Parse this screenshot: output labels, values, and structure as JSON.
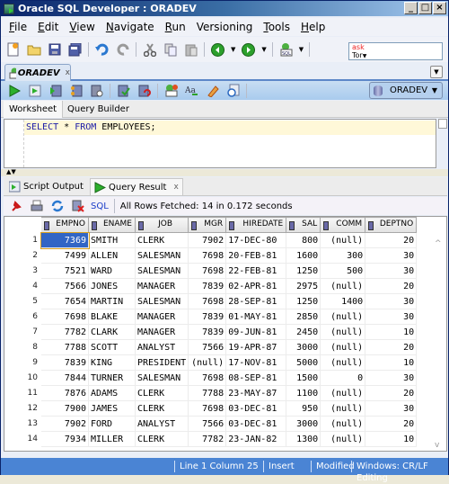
{
  "window": {
    "title": "Oracle SQL Developer : ORADEV",
    "controls": [
      "_",
      "□",
      "x"
    ]
  },
  "menu": {
    "items": [
      {
        "label": "File",
        "mnemonic": "F",
        "rest": "ile"
      },
      {
        "label": "Edit",
        "mnemonic": "E",
        "rest": "dit"
      },
      {
        "label": "View",
        "mnemonic": "V",
        "rest": "iew"
      },
      {
        "label": "Navigate",
        "mnemonic": "N",
        "rest": "avigate"
      },
      {
        "label": "Run",
        "mnemonic": "R",
        "rest": "un"
      },
      {
        "label": "Versioning",
        "mnemonic": "",
        "rest": "Versioning"
      },
      {
        "label": "Tools",
        "mnemonic": "T",
        "rest": "ools"
      },
      {
        "label": "Help",
        "mnemonic": "H",
        "rest": "elp"
      }
    ]
  },
  "toolbar": {
    "icons": [
      "new-file-icon",
      "open-folder-icon",
      "save-icon",
      "save-all-icon",
      "undo-icon",
      "redo-icon",
      "cut-icon",
      "copy-icon",
      "paste-icon",
      "back-icon",
      "forward-icon",
      "sql-connection-icon"
    ],
    "ask_line1": "ask",
    "ask_line2": "Tor"
  },
  "doc_tab": {
    "label": "ORADEV",
    "close": "x"
  },
  "worksheet_toolbar": {
    "icons": [
      "run-statement-icon",
      "run-script-icon",
      "autotrace-icon",
      "explain-plan-icon",
      "sql-tuning-icon",
      "commit-icon",
      "rollback-icon",
      "unshared-sql-icon",
      "change-case-icon",
      "clear-icon",
      "sql-history-icon"
    ],
    "connection": "ORADEV"
  },
  "subtabs": {
    "worksheet": "Worksheet",
    "query_builder": "Query Builder"
  },
  "editor": {
    "kw1": "SELECT",
    "mid": " * ",
    "kw2": "FROM",
    "rest": " EMPLOYEES;"
  },
  "result_tabs": {
    "script_output": "Script Output",
    "query_result": "Query Result",
    "close": "x"
  },
  "result_toolbar": {
    "sql_link": "SQL",
    "message": "All Rows Fetched: 14 in 0.172 seconds"
  },
  "grid": {
    "columns": [
      "EMPNO",
      "ENAME",
      "JOB",
      "MGR",
      "HIREDATE",
      "SAL",
      "COMM",
      "DEPTNO"
    ],
    "rows": [
      [
        "1",
        "7369",
        "SMITH",
        "CLERK",
        "7902",
        "17-DEC-80",
        "800",
        "(null)",
        "20"
      ],
      [
        "2",
        "7499",
        "ALLEN",
        "SALESMAN",
        "7698",
        "20-FEB-81",
        "1600",
        "300",
        "30"
      ],
      [
        "3",
        "7521",
        "WARD",
        "SALESMAN",
        "7698",
        "22-FEB-81",
        "1250",
        "500",
        "30"
      ],
      [
        "4",
        "7566",
        "JONES",
        "MANAGER",
        "7839",
        "02-APR-81",
        "2975",
        "(null)",
        "20"
      ],
      [
        "5",
        "7654",
        "MARTIN",
        "SALESMAN",
        "7698",
        "28-SEP-81",
        "1250",
        "1400",
        "30"
      ],
      [
        "6",
        "7698",
        "BLAKE",
        "MANAGER",
        "7839",
        "01-MAY-81",
        "2850",
        "(null)",
        "30"
      ],
      [
        "7",
        "7782",
        "CLARK",
        "MANAGER",
        "7839",
        "09-JUN-81",
        "2450",
        "(null)",
        "10"
      ],
      [
        "8",
        "7788",
        "SCOTT",
        "ANALYST",
        "7566",
        "19-APR-87",
        "3000",
        "(null)",
        "20"
      ],
      [
        "9",
        "7839",
        "KING",
        "PRESIDENT",
        "(null)",
        "17-NOV-81",
        "5000",
        "(null)",
        "10"
      ],
      [
        "10",
        "7844",
        "TURNER",
        "SALESMAN",
        "7698",
        "08-SEP-81",
        "1500",
        "0",
        "30"
      ],
      [
        "11",
        "7876",
        "ADAMS",
        "CLERK",
        "7788",
        "23-MAY-87",
        "1100",
        "(null)",
        "20"
      ],
      [
        "12",
        "7900",
        "JAMES",
        "CLERK",
        "7698",
        "03-DEC-81",
        "950",
        "(null)",
        "30"
      ],
      [
        "13",
        "7902",
        "FORD",
        "ANALYST",
        "7566",
        "03-DEC-81",
        "3000",
        "(null)",
        "20"
      ],
      [
        "14",
        "7934",
        "MILLER",
        "CLERK",
        "7782",
        "23-JAN-82",
        "1300",
        "(null)",
        "10"
      ]
    ]
  },
  "status": {
    "position": "Line 1 Column 25",
    "mode": "Insert",
    "modified": "Modified",
    "line_endings": "Windows: CR/LF",
    "state": "Editing"
  }
}
